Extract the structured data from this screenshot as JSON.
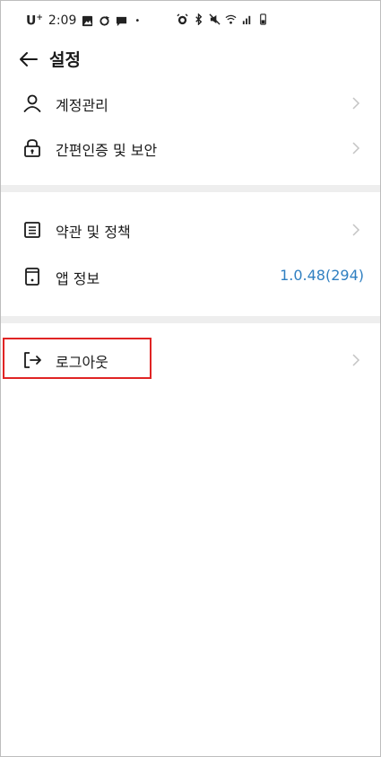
{
  "status_bar": {
    "carrier": "U",
    "carrier_sup": "+",
    "time": "2:09",
    "dot": "•"
  },
  "header": {
    "title": "설정"
  },
  "section1": {
    "account": "계정관리",
    "security": "간편인증 및 보안"
  },
  "section2": {
    "terms": "약관 및 정책",
    "app_info": "앱 정보",
    "app_version": "1.0.48(294)"
  },
  "section3": {
    "logout": "로그아웃"
  },
  "colors": {
    "accent": "#2f7fc1",
    "highlight": "#e02424",
    "divider": "#eeeeee"
  }
}
